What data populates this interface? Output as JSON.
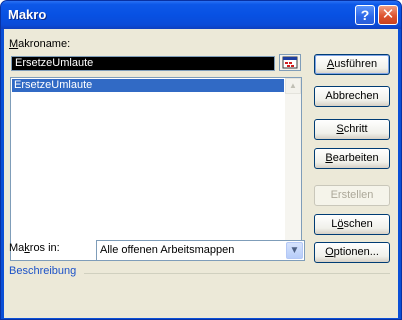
{
  "window": {
    "title": "Makro",
    "help_glyph": "?",
    "close_glyph": "✕",
    "title_color": "#0a4fd6"
  },
  "macro_name": {
    "label_key": "M",
    "label_rest": "akroname:",
    "value": "ErsetzeUmlaute"
  },
  "macro_list": {
    "items": [
      "ErsetzeUmlaute"
    ],
    "selected_index": 0,
    "selection_color": "#316ac5"
  },
  "buttons": {
    "run": {
      "key": "A",
      "rest": "usführen"
    },
    "cancel": "Abbrechen",
    "step": {
      "key": "S",
      "rest": "chritt"
    },
    "edit": {
      "key": "B",
      "rest": "earbeiten"
    },
    "create": "Erstellen",
    "delete": {
      "pre": "L",
      "key": "ö",
      "rest": "schen"
    },
    "options": {
      "key": "O",
      "rest": "ptionen..."
    }
  },
  "macros_in": {
    "label_pre": "Ma",
    "label_key": "k",
    "label_rest": "ros in:",
    "value": "Alle offenen Arbeitsmappen"
  },
  "description": {
    "label": "Beschreibung",
    "color": "#1c52c7"
  }
}
